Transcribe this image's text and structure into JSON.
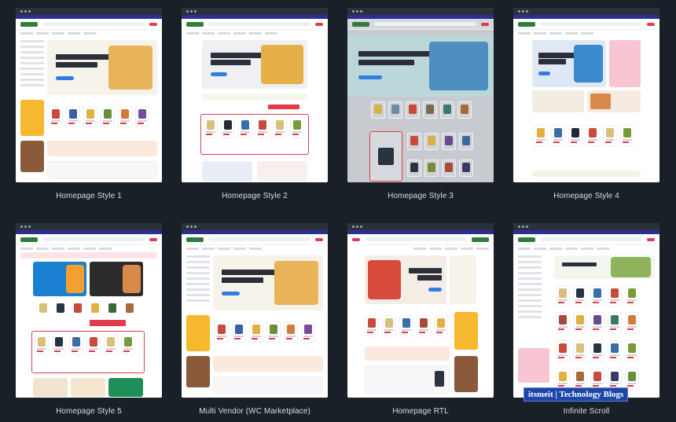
{
  "cards": [
    {
      "label": "Homepage Style 1",
      "hero_bg": "#f6f3ea",
      "hero_img": "#e9b35a",
      "hero_kind": "side-nav"
    },
    {
      "label": "Homepage Style 2",
      "hero_bg": "#eef0f2",
      "hero_img": "#e6b049",
      "hero_kind": "wide"
    },
    {
      "label": "Homepage Style 3",
      "hero_bg": "#bcd7d9",
      "hero_img": "#4f8fbf",
      "hero_kind": "full-tint"
    },
    {
      "label": "Homepage Style 4",
      "hero_bg": "#dfe9f5",
      "hero_img": "#d98a4b",
      "hero_kind": "split"
    },
    {
      "label": "Homepage Style 5",
      "hero_bg": "#1b7fd1",
      "hero_img": "#2c2c2c",
      "hero_kind": "double"
    },
    {
      "label": "Multi Vendor (WC Marketplace)",
      "hero_bg": "#f6f3ea",
      "hero_img": "#e9b35a",
      "hero_kind": "side-nav"
    },
    {
      "label": "Homepage RTL",
      "hero_bg": "#f4ede6",
      "hero_img": "#d74a3c",
      "hero_kind": "rtl"
    },
    {
      "label": "Infinite Scroll",
      "hero_bg": "#f1f6ee",
      "hero_img": "#8fb35b",
      "hero_kind": "side-nav"
    }
  ],
  "watermark": "itsmeit | Technology Blogs",
  "colors": {
    "page_bg": "#1a2027",
    "brand_green": "#2f7c3c",
    "accent_red": "#e23b4a",
    "accent_blue": "#2f7ee0"
  }
}
